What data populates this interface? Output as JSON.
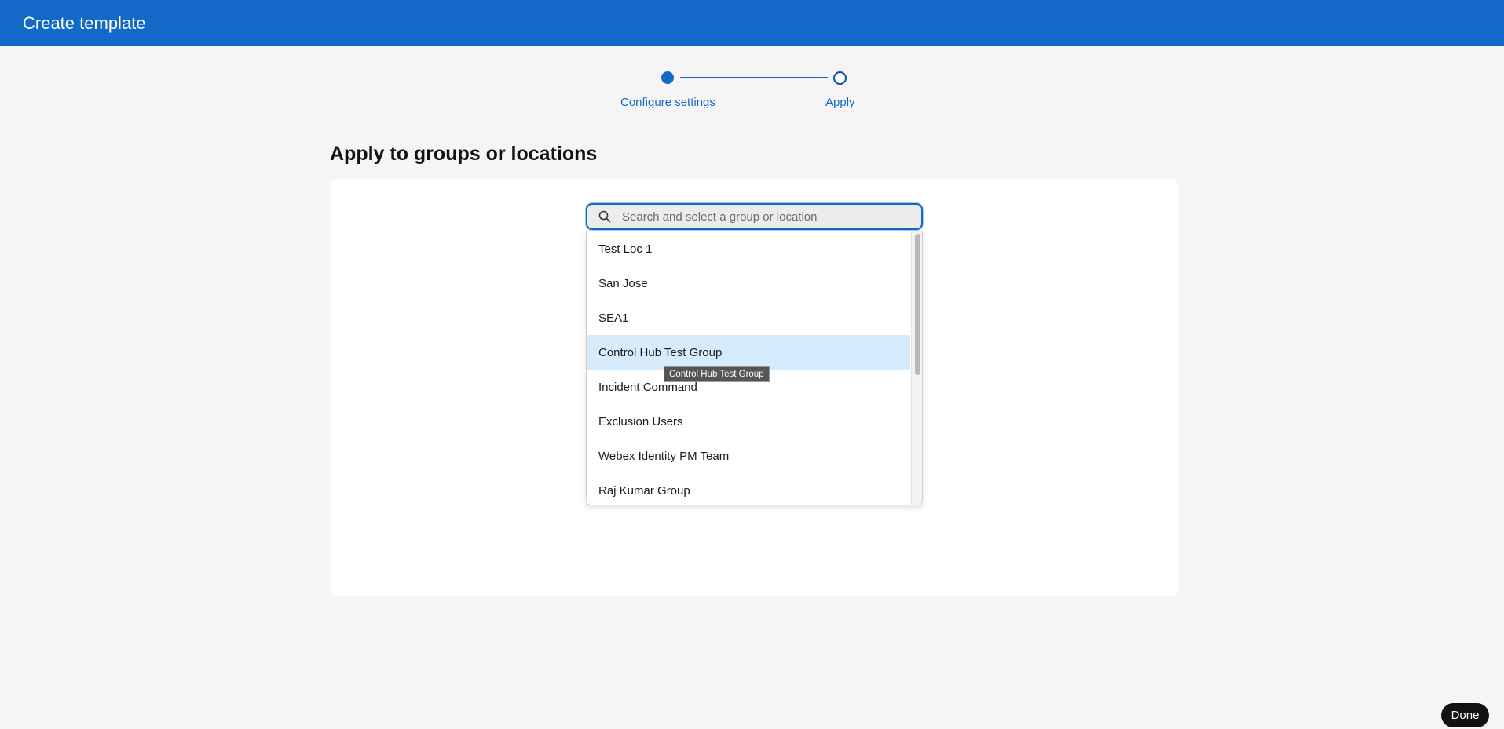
{
  "header": {
    "title": "Create template"
  },
  "stepper": {
    "steps": [
      {
        "label": "Configure settings",
        "state": "active"
      },
      {
        "label": "Apply",
        "state": "next"
      }
    ]
  },
  "section": {
    "title": "Apply to groups or locations"
  },
  "search": {
    "placeholder": "Search and select a group or location",
    "value": "",
    "icon": "search-icon"
  },
  "dropdown": {
    "items": [
      {
        "label": "Test Loc 1"
      },
      {
        "label": "San Jose"
      },
      {
        "label": "SEA1"
      },
      {
        "label": "Control Hub Test Group",
        "highlighted": true
      },
      {
        "label": "Incident Command"
      },
      {
        "label": "Exclusion Users"
      },
      {
        "label": "Webex Identity PM Team"
      },
      {
        "label": "Raj Kumar Group"
      }
    ]
  },
  "tooltip": {
    "text": "Control Hub Test Group"
  },
  "footer": {
    "done_label": "Done"
  },
  "colors": {
    "brand": "#1269c7",
    "highlight": "#d6ebfb",
    "background": "#f5f5f5"
  }
}
